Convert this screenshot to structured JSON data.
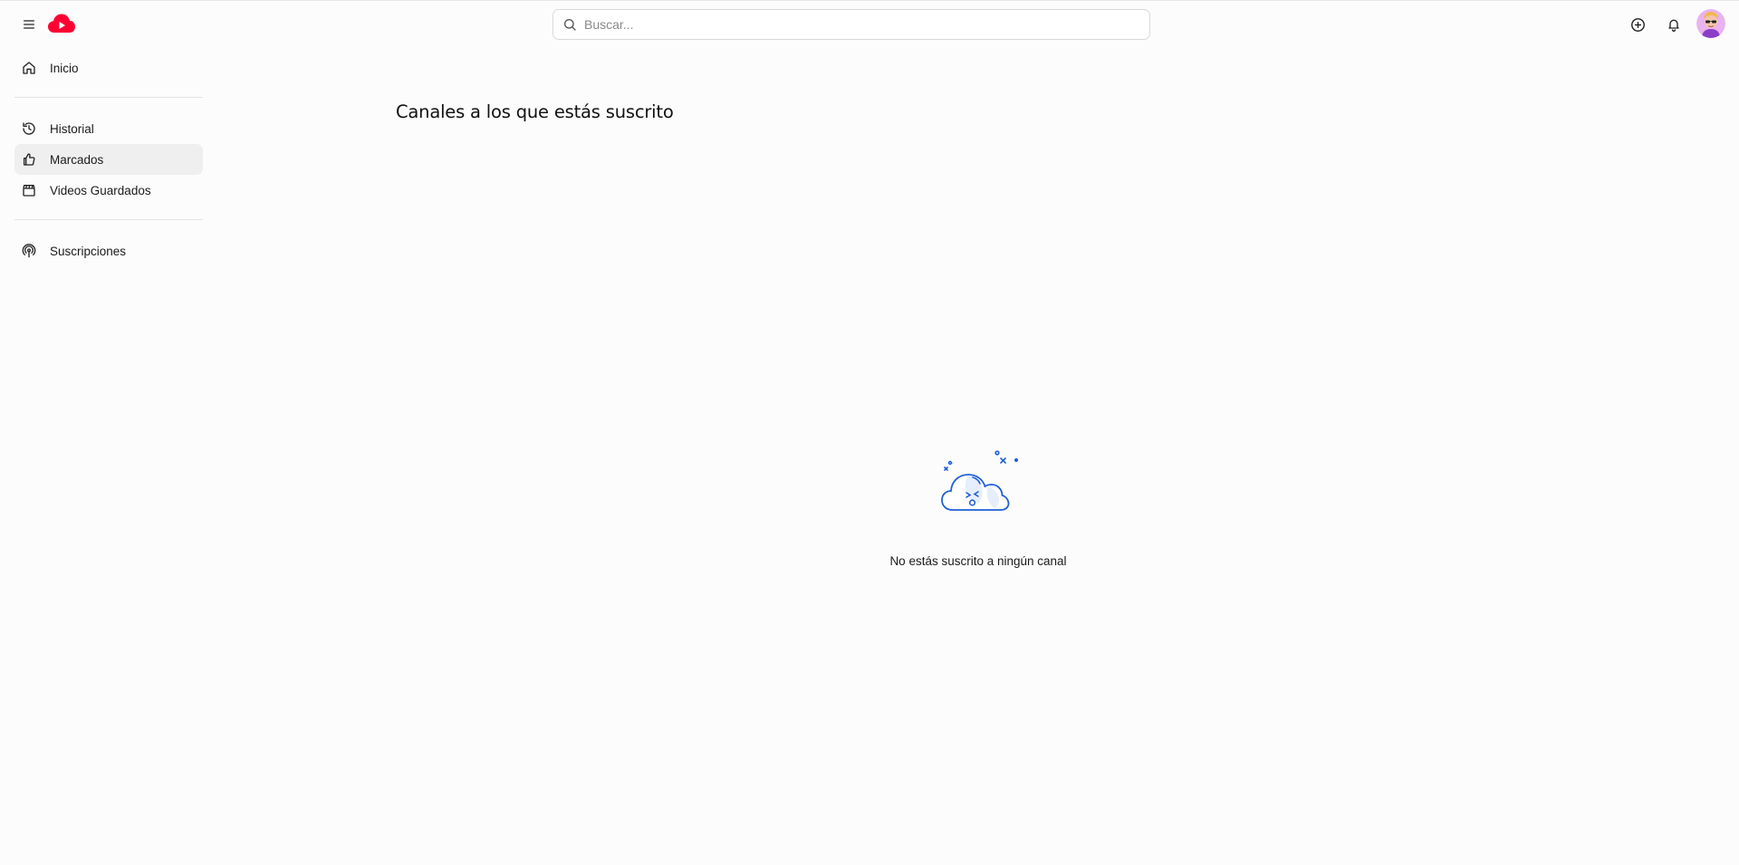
{
  "header": {
    "menu_icon": "hamburger-menu-icon",
    "logo_icon": "cloud-play-logo-icon",
    "search": {
      "placeholder": "Buscar...",
      "value": "",
      "icon": "search-icon"
    },
    "create_icon": "plus-circle-icon",
    "notifications_icon": "bell-icon",
    "avatar": "user-avatar"
  },
  "sidebar": {
    "items": [
      {
        "label": "Inicio",
        "icon": "home-icon",
        "active": false
      },
      {
        "label": "Historial",
        "icon": "history-icon",
        "active": false
      },
      {
        "label": "Marcados",
        "icon": "thumbs-up-icon",
        "active": true
      },
      {
        "label": "Videos Guardados",
        "icon": "clapperboard-icon",
        "active": false
      },
      {
        "label": "Suscripciones",
        "icon": "podcast-icon",
        "active": false
      }
    ]
  },
  "main": {
    "title": "Canales a los que estás suscrito",
    "empty_state": {
      "illustration": "sad-cloud-illustration",
      "message": "No estás suscrito a ningún canal"
    }
  },
  "colors": {
    "brand_red": "#ff0033",
    "illustration_blue": "#1f5fd6",
    "active_bg": "#efefef",
    "page_bg": "#fcfcfc"
  }
}
